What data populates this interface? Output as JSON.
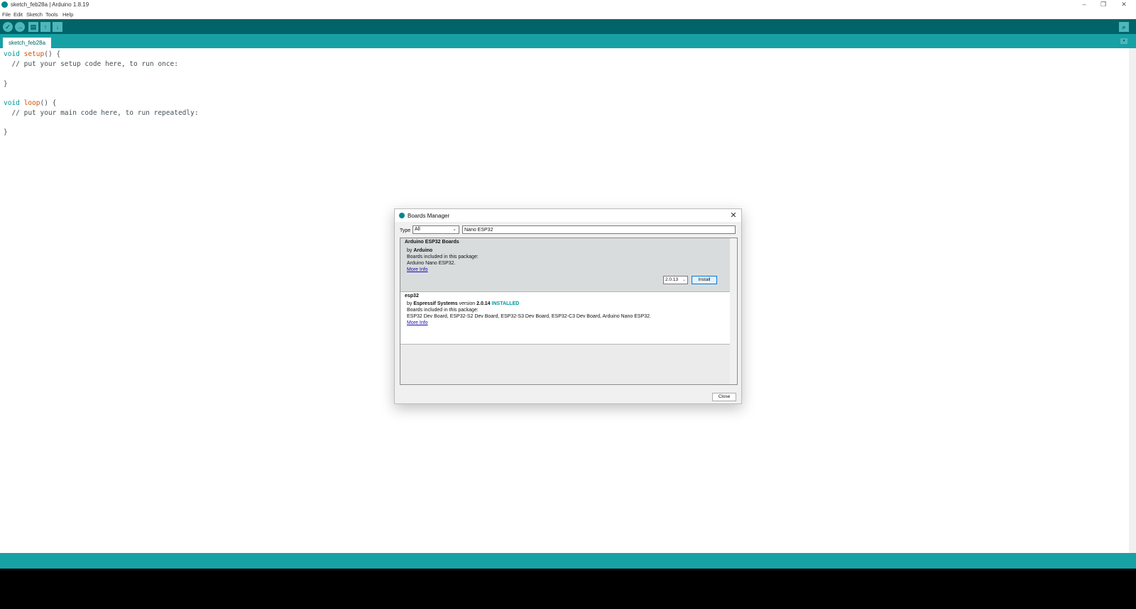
{
  "window": {
    "title": "sketch_feb28a | Arduino 1.8.19",
    "controls": {
      "minimize": "–",
      "maximize": "❐",
      "close": "✕"
    }
  },
  "menubar": {
    "items": [
      "File",
      "Edit",
      "Sketch",
      "Tools",
      "Help"
    ]
  },
  "toolbar": {
    "buttons": [
      {
        "name": "verify",
        "glyph": "✓"
      },
      {
        "name": "upload",
        "glyph": "→"
      },
      {
        "name": "new",
        "glyph": "▤"
      },
      {
        "name": "open",
        "glyph": "↑"
      },
      {
        "name": "save",
        "glyph": "↓"
      }
    ],
    "serial_monitor_glyph": "⌕"
  },
  "tabs": {
    "active": "sketch_feb28a",
    "menu_glyph": "▾"
  },
  "editor": {
    "lines": [
      {
        "kw": "void",
        "fn": "setup",
        "rest": "() {"
      },
      {
        "comment": "  // put your setup code here, to run once:"
      },
      {
        "plain": ""
      },
      {
        "plain": "}"
      },
      {
        "plain": ""
      },
      {
        "kw": "void",
        "fn": "loop",
        "rest": "() {"
      },
      {
        "comment": "  // put your main code here, to run repeatedly:"
      },
      {
        "plain": ""
      },
      {
        "plain": "}"
      }
    ]
  },
  "dialog": {
    "title": "Boards Manager",
    "close_glyph": "✕",
    "type_label": "Type",
    "type_value": "All",
    "search_value": "Nano ESP32",
    "packages": [
      {
        "name": "Arduino ESP32 Boards",
        "by": "by",
        "author": "Arduino",
        "boards_label": "Boards included in this package:",
        "boards": "Arduino Nano ESP32.",
        "more_info": "More Info",
        "version_option": "2.0.13",
        "install_label": "Install"
      },
      {
        "name": "esp32",
        "by": "by",
        "author": "Espressif Systems",
        "version_word": "version",
        "version": "2.0.14",
        "status": "INSTALLED",
        "boards_label": "Boards included in this package:",
        "boards": "ESP32 Dev Board, ESP32-S2 Dev Board, ESP32-S3 Dev Board, ESP32-C3 Dev Board, Arduino Nano ESP32.",
        "more_info": "More Info"
      }
    ],
    "close_button": "Close"
  },
  "colors": {
    "toolbar": "#006468",
    "tabbar": "#17a1a5",
    "keyword": "#00979c",
    "function": "#d35400",
    "console": "#000000"
  }
}
